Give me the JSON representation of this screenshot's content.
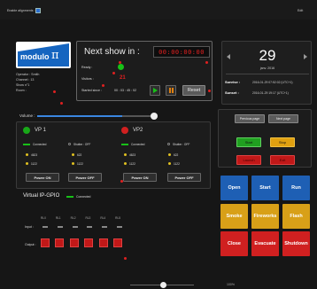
{
  "topbar": {
    "label": "Enable alignments :",
    "right": "Edit"
  },
  "logo": {
    "text": "modulo",
    "pi": "π"
  },
  "info": {
    "operator": "Operator : Smith",
    "channel": "Channel : 13",
    "show": "Show n°1",
    "room": "Room :"
  },
  "next_show": {
    "title": "Next show in :",
    "countdown": "00:00:00:00",
    "ready": "Ready :",
    "visitors_label": "Visitors :",
    "visitors": "21",
    "started_label": "Started since :",
    "started": "00 : 03 : 45 : 02",
    "reset": "Reset"
  },
  "calendar": {
    "day": "29",
    "month": "janv. 2016",
    "sunrise_label": "Sunrise :",
    "sunrise": "2016-01-29 07:52:02 (UTC+1)",
    "sunset_label": "Sunset :",
    "sunset": "2016-01-29 19:17 (UTC+1)"
  },
  "volume": {
    "label": "Volume :",
    "level": 0.72
  },
  "vp1": {
    "title": "VP 1",
    "connected": "Connected",
    "shutter": "Shutter : OFF",
    "v1": "4623",
    "v2": "622",
    "v3": "1122",
    "v4": "1122",
    "on": "Power ON",
    "off": "Power OFF"
  },
  "vp2": {
    "title": "VP2",
    "connected": "Connected",
    "shutter": "Shutter : OFF",
    "v1": "4623",
    "v2": "622",
    "v3": "1122",
    "v4": "1122",
    "on": "Power ON",
    "off": "Power OFF"
  },
  "gpio": {
    "title": "Virtual IP-GPIO",
    "connected": "Connected",
    "input": "Input :",
    "output": "Output :",
    "relays": [
      "RL0",
      "RL1",
      "RL2",
      "RL3",
      "RL4",
      "RL5"
    ]
  },
  "pages": {
    "prev": "Previous page",
    "next": "Next page",
    "start": "Start",
    "stop": "Stop",
    "red1": "Launch",
    "red2": "Exit"
  },
  "actions": [
    {
      "label": "Open",
      "color": "#1e5fb4"
    },
    {
      "label": "Start",
      "color": "#1e5fb4"
    },
    {
      "label": "Run",
      "color": "#1e5fb4"
    },
    {
      "label": "Smoke",
      "color": "#d8a018"
    },
    {
      "label": "Fireworks",
      "color": "#d8a018"
    },
    {
      "label": "Flash",
      "color": "#d8a018"
    },
    {
      "label": "Close",
      "color": "#d02020"
    },
    {
      "label": "Evacuate",
      "color": "#d02020"
    },
    {
      "label": "Shutdown",
      "color": "#d02020"
    }
  ],
  "footer": {
    "zoom": "100%"
  }
}
